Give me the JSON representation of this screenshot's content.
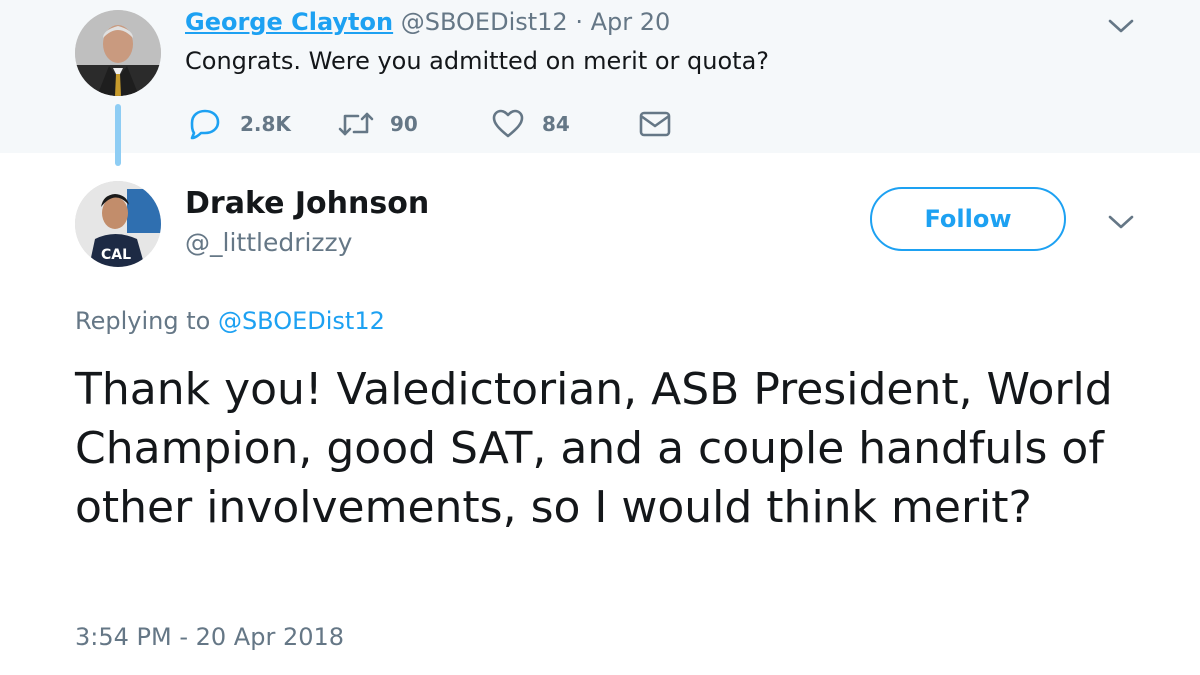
{
  "parent_tweet": {
    "author_name": "George Clayton",
    "handle": "@SBOEDist12",
    "separator": " · ",
    "date": "Apr 20",
    "text": "Congrats.  Were you admitted on merit or quota?",
    "actions": {
      "reply_icon": "reply-icon",
      "reply_count": "2.8K",
      "retweet_icon": "retweet-icon",
      "retweet_count": "90",
      "like_icon": "heart-icon",
      "like_count": "84",
      "dm_icon": "envelope-icon"
    },
    "menu_icon": "chevron-down-icon"
  },
  "reply_tweet": {
    "author_name": "Drake Johnson",
    "handle": "@_littledrizzy",
    "follow_label": "Follow",
    "menu_icon": "chevron-down-icon",
    "replying_prefix": "Replying to ",
    "replying_handle": "@SBOEDist12",
    "text": "Thank you! Valedictorian, ASB President, World Champion, good SAT, and a couple handfuls of other involvements, so I would think merit?",
    "timestamp": "3:54 PM - 20 Apr 2018"
  },
  "colors": {
    "accent": "#1da1f2",
    "muted": "#657786",
    "text": "#14171a",
    "parent_bg": "#f5f8fa",
    "thread_line": "#8ecdf4"
  }
}
